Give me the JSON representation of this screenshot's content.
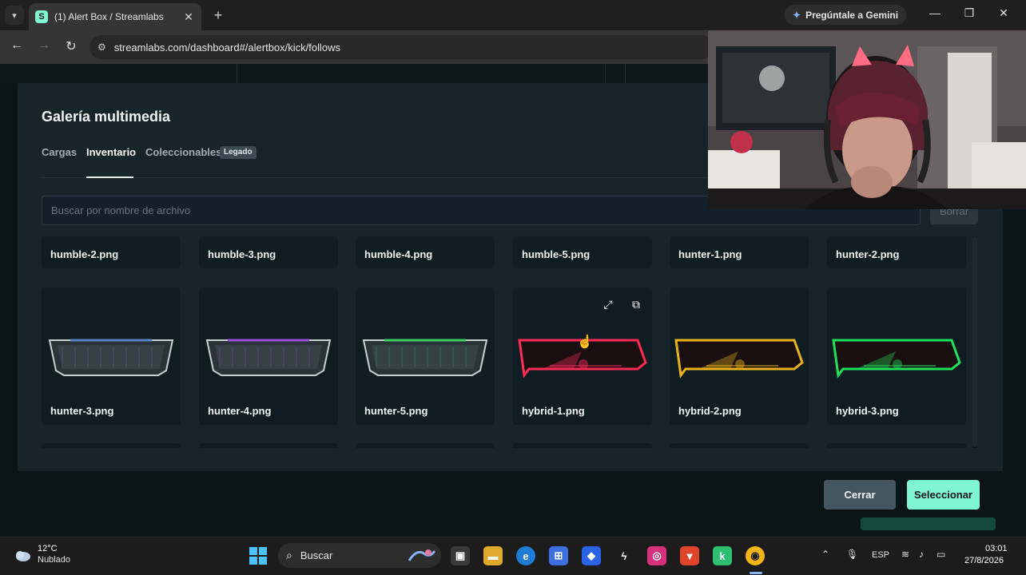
{
  "browser": {
    "tab_title": "(1) Alert Box / Streamlabs",
    "favicon_letter": "S",
    "new_tab_icon": "+",
    "gemini_label": "Pregúntale a Gemini",
    "url": "streamlabs.com/dashboard#/alertbox/kick/follows",
    "icons": [
      "tab-list-icon",
      "close-icon",
      "plus-icon",
      "sparkle-icon",
      "minimize-icon",
      "restore-icon",
      "close-window-icon",
      "back-icon",
      "forward-icon",
      "reload-icon",
      "site-info-icon"
    ]
  },
  "modal": {
    "title": "Galería multimedia",
    "tabs": [
      {
        "label": "Cargas",
        "active": false
      },
      {
        "label": "Inventario",
        "active": true
      },
      {
        "label": "Coleccionables",
        "active": false,
        "badge": "Legado"
      }
    ],
    "search_placeholder": "Buscar por nombre de archivo",
    "clear_label": "Borrar",
    "row1": [
      "humble-2.png",
      "humble-3.png",
      "humble-4.png",
      "humble-5.png",
      "hunter-1.png",
      "hunter-2.png"
    ],
    "row2": [
      {
        "name": "hunter-3.png",
        "accent": "#5a86c8",
        "style": "hunter"
      },
      {
        "name": "hunter-4.png",
        "accent": "#9a4fd8",
        "style": "hunter"
      },
      {
        "name": "hunter-5.png",
        "accent": "#3fcf63",
        "style": "hunter"
      },
      {
        "name": "hybrid-1.png",
        "accent": "#ff2a55",
        "style": "hybrid"
      },
      {
        "name": "hybrid-2.png",
        "accent": "#e8b21a",
        "style": "hybrid"
      },
      {
        "name": "hybrid-3.png",
        "accent": "#1fe05a",
        "style": "hybrid"
      }
    ],
    "hover_icons": [
      "expand-icon",
      "open-external-icon"
    ],
    "close_label": "Cerrar",
    "select_label": "Seleccionar"
  },
  "taskbar": {
    "temperature": "12°C",
    "condition": "Nublado",
    "search_label": "Buscar",
    "language": "ESP",
    "time": "03:01",
    "date": "27/8/2026"
  },
  "colors": {
    "accent": "#80f5d2",
    "modal_bg": "#17242a",
    "card_bg": "#0f1c21"
  }
}
